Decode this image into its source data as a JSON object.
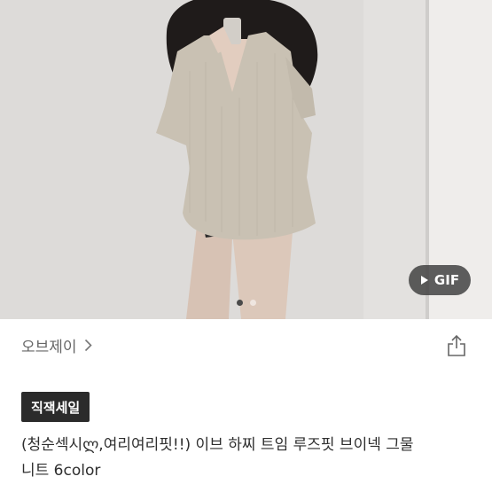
{
  "product_image": {
    "gif_label": "GIF",
    "carousel_total": 2,
    "carousel_active": 1
  },
  "seller": {
    "name": "오브제이",
    "icon": "chevron-right-icon"
  },
  "share": {
    "icon": "share-icon"
  },
  "badge": {
    "label": "직잭세일"
  },
  "product": {
    "title_line1": "(청순섹시ლ,여리여리핏!!) 이브 하찌 트임 루즈핏 브이넥 그물",
    "title_line2": "니트 6color"
  },
  "colors": {
    "badge_bg": "#2b2b2b",
    "gif_badge_bg": "#3c3c3c",
    "seller_text": "#666666",
    "title_text": "#2e2e2e"
  }
}
